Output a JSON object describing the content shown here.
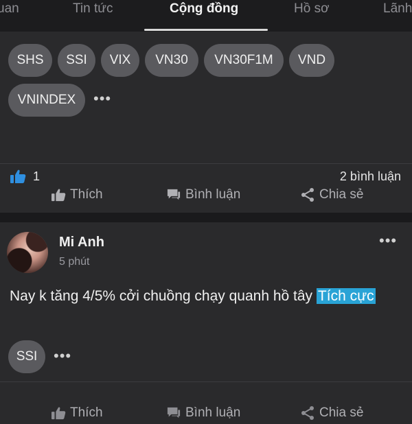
{
  "tabs": [
    {
      "label": "uan",
      "active": false
    },
    {
      "label": "Tin tức",
      "active": false
    },
    {
      "label": "Cộng đồng",
      "active": true
    },
    {
      "label": "Hồ sơ",
      "active": false
    },
    {
      "label": "Lãnh",
      "active": false
    }
  ],
  "post1": {
    "tags": [
      "SHS",
      "SSI",
      "VIX",
      "VN30",
      "VN30F1M",
      "VND",
      "VNINDEX"
    ],
    "more_tags_icon": "ellipsis-icon",
    "like_count": "1",
    "comment_count": "2 bình luận",
    "actions": {
      "like": "Thích",
      "comment": "Bình luận",
      "share": "Chia sẻ"
    }
  },
  "post2": {
    "author": "Mi Anh",
    "time": "5 phút",
    "text": "Nay k tăng 4/5% cởi chuồng chạy quanh hồ tây",
    "sentiment": "Tích cực",
    "tags": [
      "SSI"
    ],
    "actions": {
      "like": "Thích",
      "comment": "Bình luận",
      "share": "Chia sẻ"
    }
  },
  "colors": {
    "background": "#2a2a2c",
    "tabbar": "#1c1c1e",
    "chip": "#5a5a5e",
    "sentiment_highlight": "#29a3d6",
    "like_icon": "#2f8fe0"
  }
}
